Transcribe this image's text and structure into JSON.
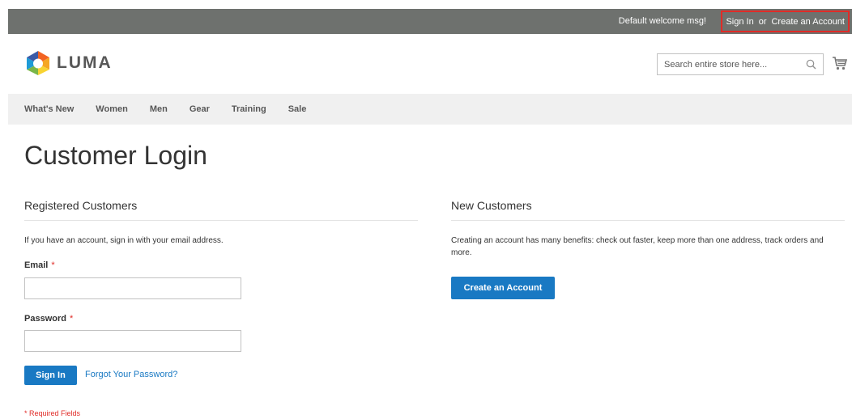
{
  "top_panel": {
    "welcome": "Default welcome msg!",
    "sign_in": "Sign In",
    "or": "or",
    "create_account": "Create an Account"
  },
  "header": {
    "logo_text": "LUMA",
    "search": {
      "placeholder": "Search entire store here...",
      "value": ""
    },
    "icons": {
      "search": "search-icon",
      "cart": "cart-icon"
    }
  },
  "nav": {
    "items": [
      "What's New",
      "Women",
      "Men",
      "Gear",
      "Training",
      "Sale"
    ]
  },
  "page_title": "Customer Login",
  "registered": {
    "title": "Registered Customers",
    "note": "If you have an account, sign in with your email address.",
    "email_label": "Email",
    "password_label": "Password",
    "required_mark": "*",
    "email_value": "",
    "password_value": "",
    "sign_in_button": "Sign In",
    "forgot_link": "Forgot Your Password?",
    "required_note": "* Required Fields"
  },
  "new_customers": {
    "title": "New Customers",
    "note": "Creating an account has many benefits: check out faster, keep more than one address, track orders and more.",
    "create_button": "Create an Account"
  },
  "colors": {
    "top_panel_bg": "#6e716e",
    "highlight_border": "#e02b27",
    "primary": "#1979c3",
    "nav_bg": "#f0f0f0",
    "required": "#e02b27"
  }
}
